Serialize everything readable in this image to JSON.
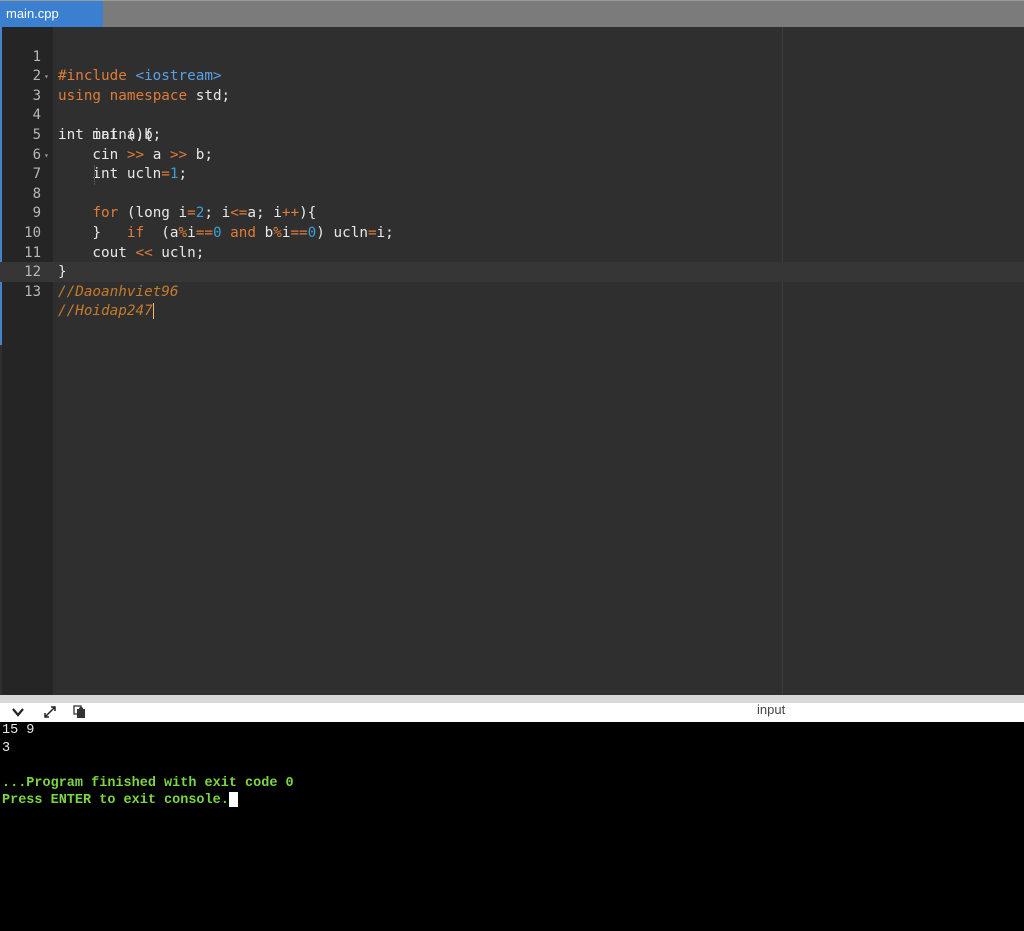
{
  "tab": {
    "filename": "main.cpp"
  },
  "editor": {
    "line_numbers": [
      "1",
      "2",
      "3",
      "4",
      "5",
      "6",
      "7",
      "8",
      "9",
      "10",
      "11",
      "12",
      "13"
    ],
    "lines": {
      "l1_pp": "#include ",
      "l1_inc": "<iostream>",
      "l2_using": "using",
      "l2_ns": "namespace",
      "l2_std": " std;",
      "l3": "int main(){",
      "l4": "    int a,b;",
      "l5_a": "    cin ",
      "l5_op1": ">>",
      "l5_b": " a ",
      "l5_op2": ">>",
      "l5_c": " b;",
      "l6_a": "    int ucln",
      "l6_eq": "=",
      "l6_num": "1",
      "l6_c": ";",
      "l7_for": "for",
      "l7_a": " (long i",
      "l7_eq": "=",
      "l7_num": "2",
      "l7_b": "; i",
      "l7_le": "<=",
      "l7_c": "a; i",
      "l7_pp": "++",
      "l7_d": "){",
      "l8_if": "if",
      "l8_a": "  (a",
      "l8_mod1": "%",
      "l8_b": "i",
      "l8_eq1": "==",
      "l8_n1": "0",
      "l8_and": " and ",
      "l8_c": "b",
      "l8_mod2": "%",
      "l8_d": "i",
      "l8_eq2": "==",
      "l8_n2": "0",
      "l8_e": ") ucln",
      "l8_asg": "=",
      "l8_f": "i;",
      "l9": "    }",
      "l10_a": "    cout ",
      "l10_op": "<<",
      "l10_b": " ucln;",
      "l11": "}",
      "l12": "//Daoanhviet96",
      "l13": "//Hoidap247"
    }
  },
  "console_bar": {
    "collapse_icon": "chevron-down-icon",
    "expand_icon": "expand-icon",
    "copy_icon": "copy-icon",
    "input_label": "input"
  },
  "console": {
    "line1": "15 9",
    "line2": "3",
    "line3": "",
    "line4": "...Program finished with exit code 0",
    "line5": "Press ENTER to exit console."
  }
}
